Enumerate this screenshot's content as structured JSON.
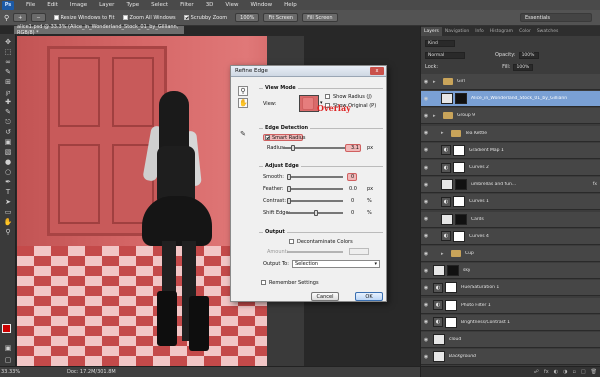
{
  "app": {
    "logo": "Ps"
  },
  "menu": [
    "File",
    "Edit",
    "Image",
    "Layer",
    "Type",
    "Select",
    "Filter",
    "3D",
    "View",
    "Window",
    "Help"
  ],
  "options_bar": {
    "resize_label": "Resize Windows to Fit",
    "zoom_all_label": "Zoom All Windows",
    "scrubby_label": "Scrubby Zoom",
    "btn_100": "100%",
    "fit_screen": "Fit Screen",
    "fill_screen": "Fill Screen",
    "workspace": "Essentials"
  },
  "document": {
    "tab_title": "alice1.psd @ 33.3% (Alice_in_Wonderland_Stock_01_by_Gilliann, RGB/8) *",
    "zoom": "33.33%",
    "doc_size": "Doc: 17.2M/301.8M"
  },
  "dialog": {
    "title": "Refine Edge",
    "close": "x",
    "view_mode": {
      "heading": "View Mode",
      "view_label": "View:",
      "show_radius": "Show Radius (J)",
      "show_original": "Show Original (P)",
      "overlay_note": "Overlay"
    },
    "edge_detection": {
      "heading": "Edge Detection",
      "smart_radius": "Smart Radius",
      "radius_label": "Radius:",
      "radius_value": "3.1",
      "radius_unit": "px",
      "radius_frac": 0.12
    },
    "adjust_edge": {
      "heading": "Adjust Edge",
      "smooth_label": "Smooth:",
      "smooth_value": "0",
      "feather_label": "Feather:",
      "feather_value": "0.0",
      "feather_unit": "px",
      "contrast_label": "Contrast:",
      "contrast_value": "0",
      "contrast_unit": "%",
      "shift_label": "Shift Edge:",
      "shift_value": "0",
      "shift_unit": "%"
    },
    "output": {
      "heading": "Output",
      "decontaminate": "Decontaminate Colors",
      "amount_label": "Amount:",
      "output_to_label": "Output To:",
      "output_to_value": "Selection"
    },
    "remember": "Remember Settings",
    "cancel": "Cancel",
    "ok": "OK"
  },
  "panels": {
    "tabs": [
      "Layers",
      "Navigation",
      "Info",
      "Histogram",
      "Color",
      "Swatches"
    ],
    "kind": "Kind",
    "blend": "Normal",
    "opacity_label": "Opacity:",
    "opacity_value": "100%",
    "lock_label": "Lock:",
    "fill_label": "Fill:",
    "fill_value": "100%",
    "layers": [
      {
        "name": "Girl",
        "kind": "folder",
        "indent": 0
      },
      {
        "name": "Alice_in_Wonderland_Stock_01_by_Gilliann",
        "kind": "image",
        "indent": 1,
        "selected": true
      },
      {
        "name": "Group 9",
        "kind": "folder",
        "indent": 0
      },
      {
        "name": "Tea Kettle",
        "kind": "folder",
        "indent": 1
      },
      {
        "name": "Gradient Map 1",
        "kind": "adjust",
        "indent": 1
      },
      {
        "name": "Curves 2",
        "kind": "adjust",
        "indent": 1
      },
      {
        "name": "umbrellas and fun...",
        "kind": "image",
        "indent": 1,
        "fx": "fx"
      },
      {
        "name": "Curves 1",
        "kind": "adjust",
        "indent": 1
      },
      {
        "name": "Cards",
        "kind": "image",
        "indent": 1
      },
      {
        "name": "Curves 4",
        "kind": "adjust",
        "indent": 1
      },
      {
        "name": "Cup",
        "kind": "folder",
        "indent": 1
      },
      {
        "name": "sky",
        "kind": "image",
        "indent": 0
      },
      {
        "name": "Hue/Saturation 1",
        "kind": "adjust",
        "indent": 0
      },
      {
        "name": "Photo Filter 1",
        "kind": "adjust",
        "indent": 0
      },
      {
        "name": "Brightness/Contrast 1",
        "kind": "adjust",
        "indent": 0
      },
      {
        "name": "cloud",
        "kind": "image",
        "indent": 0
      },
      {
        "name": "Background",
        "kind": "image",
        "indent": 0
      }
    ]
  }
}
